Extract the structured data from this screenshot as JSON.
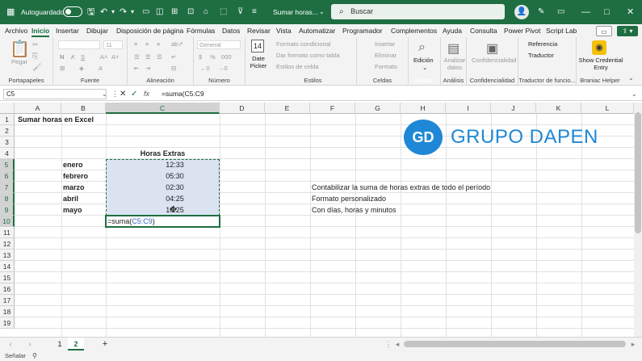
{
  "titlebar": {
    "autosave_label": "Autoguardado",
    "file_name": "Sumar horas...",
    "search_placeholder": "Buscar",
    "avatar_initial": "👤"
  },
  "tabs": [
    "Archivo",
    "Inicio",
    "Insertar",
    "Dibujar",
    "Disposición de página",
    "Fórmulas",
    "Datos",
    "Revisar",
    "Vista",
    "Automatizar",
    "Programador",
    "Complementos",
    "Ayuda",
    "Consulta",
    "Power Pivot",
    "Script Lab"
  ],
  "active_tab": "Inicio",
  "ribbon": {
    "groups": [
      "Portapapeles",
      "Fuente",
      "Alineación",
      "Número",
      "Estilos",
      "Celdas",
      "Edición",
      "Análisis",
      "Confidencialidad",
      "Traductor de funcio...",
      "Braniac Helper"
    ],
    "paste_label": "Pegar",
    "font_size": "11",
    "number_format": "General",
    "date_picker_label": "Date Picker",
    "date_picker_day": "14",
    "styles": [
      "Formato condicional",
      "Dar formato como tabla",
      "Estilos de celda"
    ],
    "cells": [
      "Insertar",
      "Eliminar",
      "Formato"
    ],
    "edicion_label": "Edición",
    "analizar_label": "Analizar datos",
    "confidencialidad_label": "Confidencialidad",
    "referencia_label": "Referencia",
    "traductor_label": "Traductor",
    "show_credential_label": "Show Credential Entry"
  },
  "formula": {
    "name_box": "C5",
    "content": "=suma(C5:C9"
  },
  "columns": [
    "A",
    "B",
    "C",
    "D",
    "E",
    "F",
    "G",
    "H",
    "I",
    "J",
    "K",
    "L"
  ],
  "rows": [
    "1",
    "2",
    "3",
    "4",
    "5",
    "6",
    "7",
    "8",
    "9",
    "10",
    "11",
    "12",
    "13",
    "14",
    "15",
    "16",
    "17",
    "18",
    "19"
  ],
  "sheet": {
    "a1": "Sumar horas en Excel",
    "c4": "Horas Extras",
    "months": [
      "enero",
      "febrero",
      "marzo",
      "abril",
      "mayo"
    ],
    "hours": [
      "12:33",
      "05:30",
      "02:30",
      "04:25",
      "10:25"
    ],
    "c10_prefix": "=suma(",
    "c10_ref": "C5:C9",
    "c10_suffix": ")",
    "f7": "Contabilizar la suma de horas extras de todo el período",
    "f8": "Formato personalizado",
    "f9": "Con días, horas y minutos"
  },
  "logo": {
    "initials": "GD",
    "text": "GRUPO DAPEN"
  },
  "sheet_tabs": [
    "1",
    "2"
  ],
  "active_sheet": "2",
  "status": {
    "mode": "Señalar"
  },
  "colors": {
    "excel_green": "#1e6e42",
    "logo_blue": "#1e88d6",
    "selection_fill": "#dbe3f1"
  }
}
